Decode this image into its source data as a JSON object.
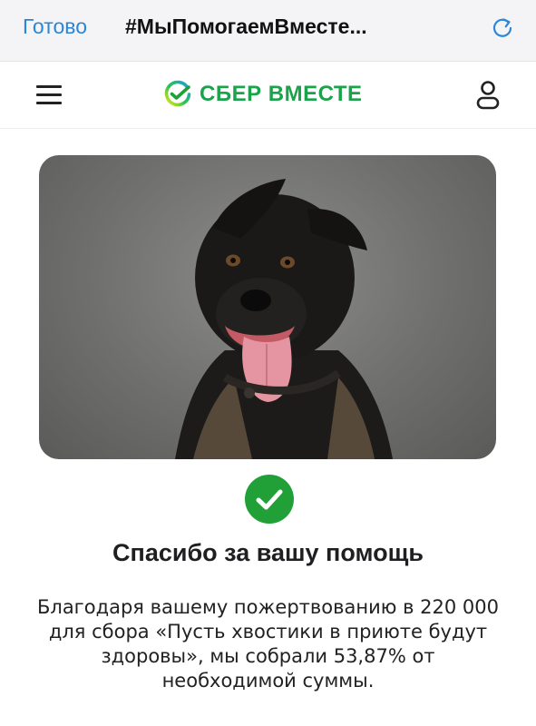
{
  "browser": {
    "done_label": "Готово",
    "title": "#МыПомогаемВместе...",
    "reload_icon": "reload-icon"
  },
  "header": {
    "menu_icon": "hamburger-menu-icon",
    "logo_text": "СБЕР ВМЕСТЕ",
    "user_icon": "user-profile-icon",
    "brand_color": "#21a038"
  },
  "hero": {
    "image": "photo of a smiling black dog with tongue out on grey background"
  },
  "success": {
    "icon": "check-circle-icon",
    "color": "#21a038",
    "title": "Спасибо за вашу помощь",
    "body_lines": [
      "Благодаря вашему пожертвованию в 220 000",
      "для сбора «Пусть хвостики в приюте будут",
      "здоровы», мы собрали 53,87% от",
      "необходимой суммы."
    ]
  }
}
